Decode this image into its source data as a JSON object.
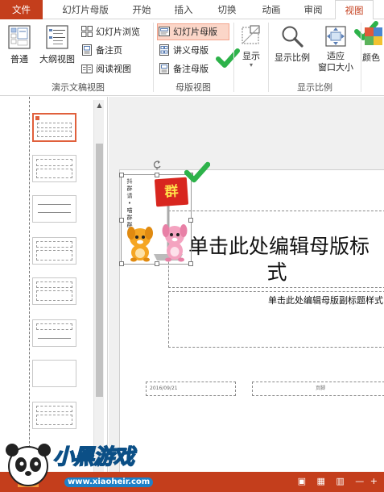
{
  "tabs": [
    {
      "label": "文件"
    },
    {
      "label": "幻灯片母版"
    },
    {
      "label": "开始"
    },
    {
      "label": "插入"
    },
    {
      "label": "切换"
    },
    {
      "label": "动画"
    },
    {
      "label": "审阅"
    },
    {
      "label": "视图"
    }
  ],
  "ribbon": {
    "presentation_views": {
      "label": "演示文稿视图",
      "normal": "普通",
      "outline": "大纲视图",
      "slide_sorter": "幻灯片浏览",
      "notes_page": "备注页",
      "reading_view": "阅读视图"
    },
    "master_views": {
      "label": "母版视图",
      "slide_master": "幻灯片母版",
      "handout_master": "讲义母版",
      "notes_master": "备注母版"
    },
    "show": {
      "label": "显示"
    },
    "zoom": {
      "label": "显示比例",
      "zoom": "显示比例",
      "fit_line1": "适应",
      "fit_line2": "窗口大小"
    },
    "color": {
      "label": "颜色"
    }
  },
  "slide": {
    "title": "单击此处编辑母版标题样式",
    "title_line1": "单击此处编辑母版标",
    "title_line2": "式",
    "subtitle": "单击此处编辑母版副标题样式",
    "date": "2016/09/21",
    "footer": "页脚"
  },
  "sticker": {
    "banner": "群",
    "side_text": [
      "抖",
      "群",
      "请",
      "•",
      "喵",
      "群",
      "群"
    ]
  },
  "watermark": {
    "brand": "小黑游戏",
    "url": "www.xiaoheir.com"
  },
  "colors": {
    "accent": "#c43e1c",
    "selected_bg": "#fbd6c8",
    "check": "#2db24a"
  }
}
